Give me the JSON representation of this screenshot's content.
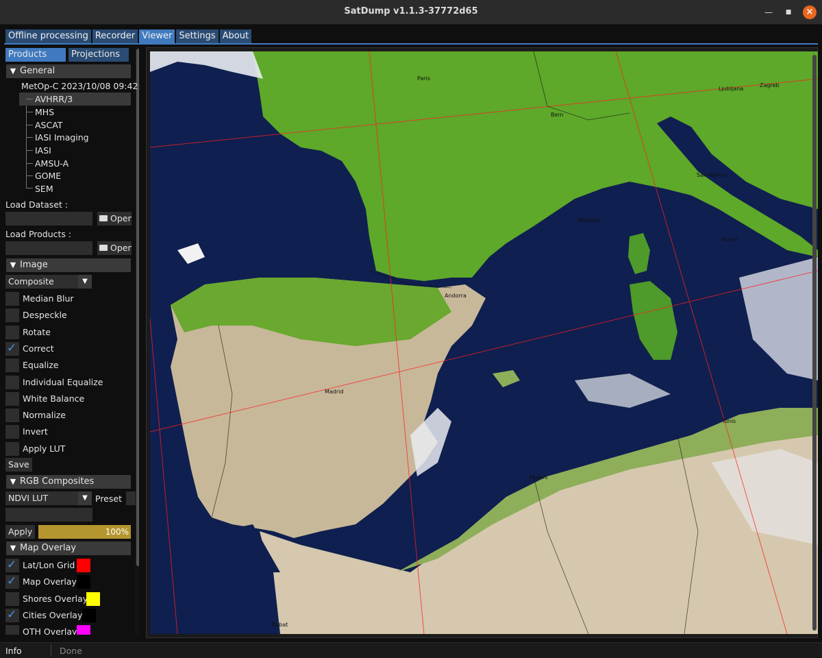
{
  "window": {
    "title": "SatDump v1.1.3-37772d65"
  },
  "tabs": [
    "Offline processing",
    "Recorder",
    "Viewer",
    "Settings",
    "About"
  ],
  "subtabs": [
    "Products",
    "Projections"
  ],
  "general": {
    "header": "General",
    "root": "MetOp-C 2023/10/08 09:42:",
    "items": [
      "AVHRR/3",
      "MHS",
      "ASCAT",
      "IASI Imaging",
      "IASI",
      "AMSU-A",
      "GOME",
      "SEM"
    ]
  },
  "load": {
    "dataset_label": "Load Dataset :",
    "products_label": "Load Products :",
    "open_label": "Open"
  },
  "image": {
    "header": "Image",
    "mode": "Composite",
    "options": [
      {
        "label": "Median Blur",
        "checked": false
      },
      {
        "label": "Despeckle",
        "checked": false
      },
      {
        "label": "Rotate",
        "checked": false
      },
      {
        "label": "Correct",
        "checked": true
      },
      {
        "label": "Equalize",
        "checked": false
      },
      {
        "label": "Individual Equalize",
        "checked": false
      },
      {
        "label": "White Balance",
        "checked": false
      },
      {
        "label": "Normalize",
        "checked": false
      },
      {
        "label": "Invert",
        "checked": false
      },
      {
        "label": "Apply LUT",
        "checked": false
      }
    ],
    "save_label": "Save"
  },
  "rgb": {
    "header": "RGB Composites",
    "composite": "NDVI LUT",
    "preset_label": "Preset",
    "apply_label": "Apply",
    "progress_text": "100%",
    "progress": 1.0
  },
  "overlay": {
    "header": "Map Overlay",
    "items": [
      {
        "label": "Lat/Lon Grid",
        "checked": true,
        "color": "#ff0000"
      },
      {
        "label": "Map Overlay",
        "checked": true,
        "color": "#000000"
      },
      {
        "label": "Shores Overlay",
        "checked": false,
        "color": "#ffff00"
      },
      {
        "label": "Cities Overlay",
        "checked": true,
        "color": "#000000"
      },
      {
        "label": "QTH Overlay",
        "checked": false,
        "color": "#ff00ff"
      }
    ]
  },
  "map": {
    "cities": [
      "Paris",
      "Bern",
      "Ljubljana",
      "Zagreb",
      "San Marino",
      "Monaco",
      "Rome",
      "Andorra",
      "Madrid",
      "Tunis",
      "Algiers",
      "Rabat"
    ]
  },
  "status": {
    "label": "Info",
    "message": "Done"
  },
  "colors": {
    "accent": "#3f7ac0",
    "tab": "#2a4c74",
    "sea": "#0f1f4f",
    "land": "#5ea82a",
    "progress": "#b5952e"
  }
}
